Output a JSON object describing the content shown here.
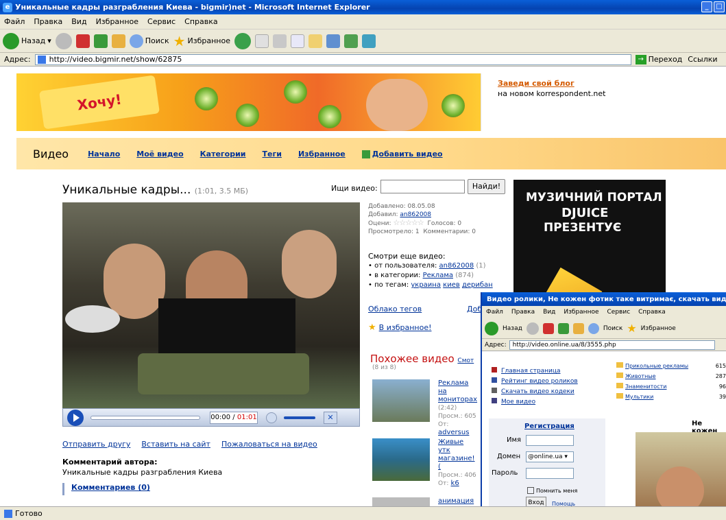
{
  "window": {
    "title": "Уникальные кадры разграбления Киева - bigmir)net - Microsoft Internet Explorer"
  },
  "menu": [
    "Файл",
    "Правка",
    "Вид",
    "Избранное",
    "Сервис",
    "Справка"
  ],
  "toolbar": {
    "back": "Назад",
    "search": "Поиск",
    "favorites": "Избранное"
  },
  "address": {
    "label": "Адрес:",
    "url": "http://video.bigmir.net/show/62875",
    "go": "Переход",
    "links": "Ссылки"
  },
  "status": "Готово",
  "banner": {
    "candy_text": "Хочу!",
    "promo_link": "Заведи свой блог",
    "promo_text": "на новом korrespondent.net"
  },
  "nav": {
    "brand": "Видео",
    "items": [
      "Начало",
      "Моё видео",
      "Категории",
      "Теги",
      "Избранное",
      "Добавить видео"
    ]
  },
  "video": {
    "title": "Уникальные кадры...",
    "meta": "(1:01, 3.5 МБ)",
    "time_current": "00:00 /",
    "time_total": "01:01"
  },
  "search": {
    "label": "Ищи видео:",
    "button": "Найди!"
  },
  "info": {
    "added": "Добавлено: 08.05.08",
    "by_label": "Добавил:",
    "by_user": "an862008",
    "rating_label": "Оцени:",
    "votes": "Голосов: 0",
    "views": "Просмотрело: 1",
    "comments": "Комментарии: 0"
  },
  "more": {
    "title": "Смотри еще видео:",
    "user_label": "от пользователя:",
    "user": "an862008",
    "user_count": "(1)",
    "cat_label": "в категории:",
    "cat": "Реклама",
    "cat_count": "(874)",
    "tags_label": "по тегам:",
    "tags": [
      "украина",
      "киев",
      "дерибан"
    ]
  },
  "tagcloud": {
    "link": "Облако тегов",
    "add": "Доб"
  },
  "favorite": "В избранное!",
  "under_links": [
    "Отправить другу",
    "Вставить на сайт",
    "Пожаловаться на видео"
  ],
  "author": {
    "heading": "Комментарий автора:",
    "text": "Уникальные кадры разграбления Киева"
  },
  "comments_link": "Комментариев (0)",
  "similar": {
    "title": "Похожее видео",
    "more": "Смот",
    "count": "(8 из 8)",
    "items": [
      {
        "title1": "Реклама на",
        "title2": "мониторах",
        "dur": "(2:42)",
        "views": "Просм.: 605",
        "from_label": "От:",
        "from": "adversus"
      },
      {
        "title1": "Живые утк",
        "title2": "магазине! (",
        "dur": "",
        "views": "Просм.: 406",
        "from_label": "От:",
        "from": "k6"
      },
      {
        "title1": "анимация в",
        "title2": "",
        "dur": "",
        "views": "",
        "from_label": "",
        "from": ""
      }
    ]
  },
  "ad": {
    "line1": "МУЗИЧНИЙ ПОРТАЛ",
    "line2": "DJUICE",
    "line3": "ПРЕЗЕНТУЄ"
  },
  "popup": {
    "title": "Видео ролики, Не кожен фотик таке витримає, скачать видео ро",
    "menu": [
      "Файл",
      "Правка",
      "Вид",
      "Избранное",
      "Сервис",
      "Справка"
    ],
    "toolbar": {
      "back": "Назад",
      "search": "Поиск",
      "favorites": "Избранное"
    },
    "address_label": "Адрес:",
    "url": "http://video.online.ua/8/3555.php",
    "links": [
      "Главная страница",
      "Рейтинг видео роликов",
      "Скачать видео кодеки",
      "Мое видео"
    ],
    "cats": [
      {
        "name": "Прикольные рекламы",
        "count": "615"
      },
      {
        "name": "Животные",
        "count": "287"
      },
      {
        "name": "Знаменитости",
        "count": "96"
      },
      {
        "name": "Мультики",
        "count": "39"
      }
    ],
    "reg": {
      "title": "Регистрация",
      "name": "Имя",
      "domain": "Домен",
      "domain_value": "@online.ua",
      "password": "Пароль",
      "remember": "Помнить меня",
      "login": "Вход",
      "help": "Помощь"
    },
    "right_heading": "Не кожен"
  }
}
